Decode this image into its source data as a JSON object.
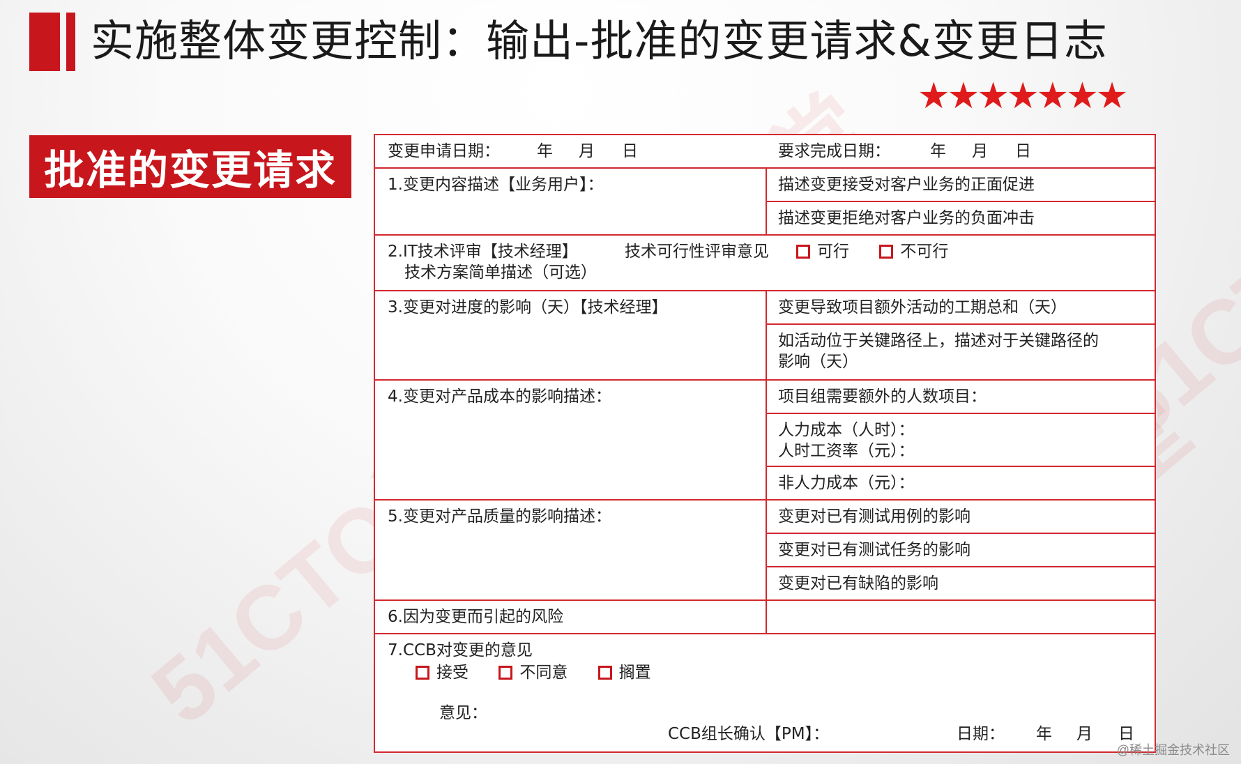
{
  "header": {
    "title": "实施整体变更控制：输出-批准的变更请求&变更日志",
    "stars": "★★★★★★★"
  },
  "badge": "批准的变更请求",
  "watermark": "51CTO学堂",
  "form": {
    "request_date": {
      "label": "变更申请日期：",
      "year": "年",
      "month": "月",
      "day": "日"
    },
    "due_date": {
      "label": "要求完成日期：",
      "year": "年",
      "month": "月",
      "day": "日"
    },
    "s1": {
      "label": "1.变更内容描述【业务用户】：",
      "right": [
        "描述变更接受对客户业务的正面促进",
        "描述变更拒绝对客户业务的负面冲击"
      ]
    },
    "s2": {
      "label": "2.IT技术评审【技术经理】",
      "opinion": "技术可行性评审意见",
      "options": [
        "可行",
        "不可行"
      ],
      "sub": "技术方案简单描述（可选）"
    },
    "s3": {
      "label": "3.变更对进度的影响（天）【技术经理】",
      "right": [
        "变更导致项目额外活动的工期总和（天）",
        "如活动位于关键路径上，描述对于关键路径的",
        "影响（天）"
      ]
    },
    "s4": {
      "label": "4.变更对产品成本的影响描述：",
      "right": [
        "项目组需要额外的人数项目：",
        "人力成本（人时）：",
        "人时工资率（元）：",
        "非人力成本（元）："
      ]
    },
    "s5": {
      "label": "5.变更对产品质量的影响描述：",
      "right": [
        "变更对已有测试用例的影响",
        "变更对已有测试任务的影响",
        "变更对已有缺陷的影响"
      ]
    },
    "s6": {
      "label": "6.因为变更而引起的风险"
    },
    "s7": {
      "label": "7.CCB对变更的意见",
      "options": [
        "接受",
        "不同意",
        "搁置"
      ],
      "opinion_label": "意见：",
      "confirm": "CCB组长确认【PM】：",
      "date_label": "日期：",
      "year": "年",
      "month": "月",
      "day": "日"
    }
  },
  "footer_note": "@稀土掘金技术社区"
}
